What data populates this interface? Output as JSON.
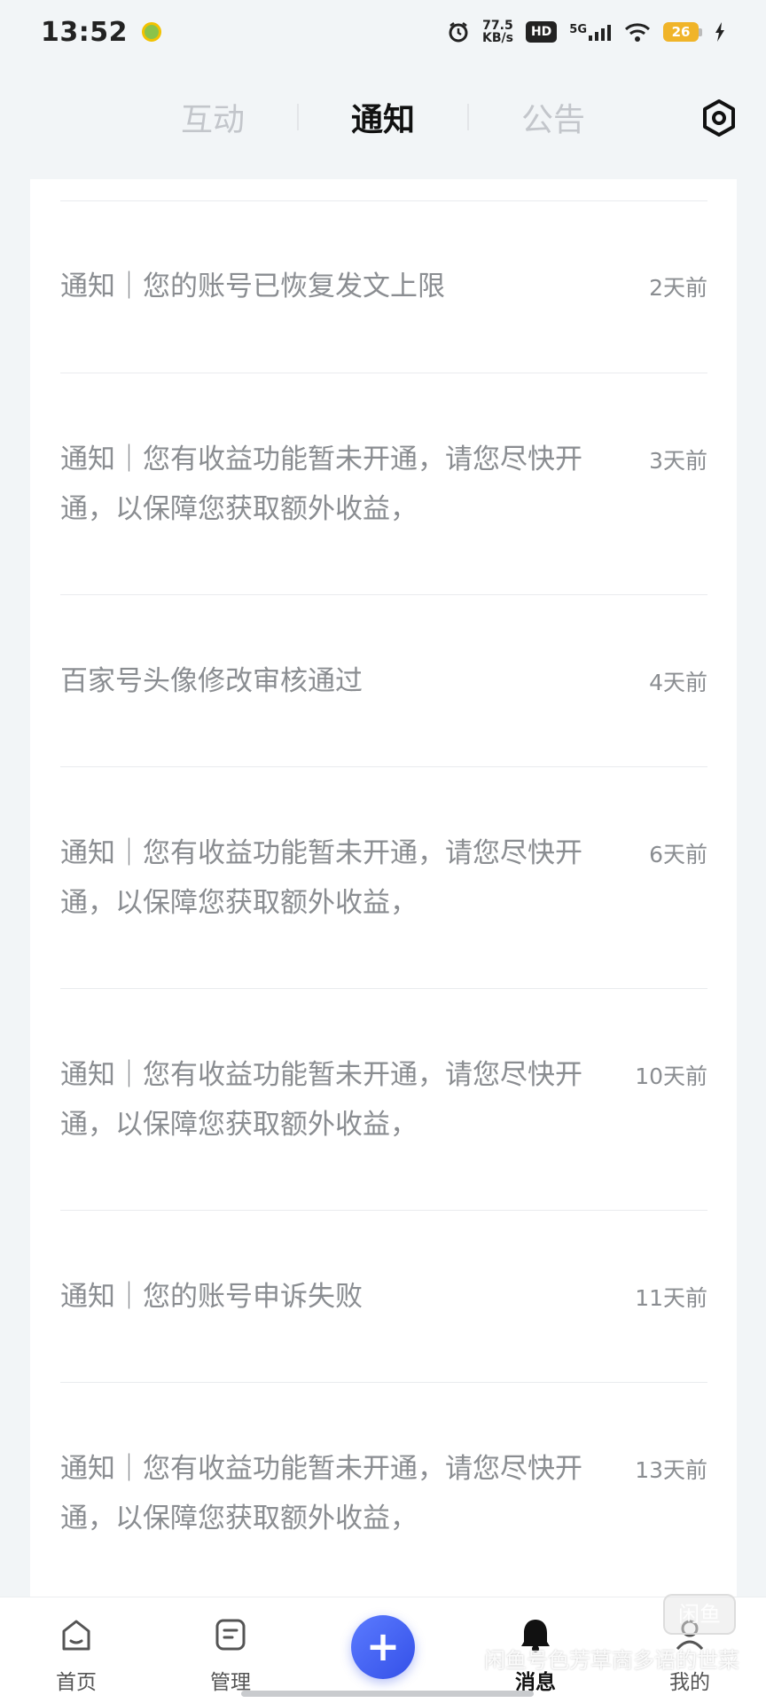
{
  "status_bar": {
    "time": "13:52",
    "speed_value": "77.5",
    "speed_unit": "KB/s",
    "hd_label": "HD",
    "network_label": "5G",
    "battery_level": "26"
  },
  "tabs": {
    "items": [
      {
        "label": "互动"
      },
      {
        "label": "通知"
      },
      {
        "label": "公告"
      }
    ],
    "active_index": 1
  },
  "notifications": [
    {
      "text": "通知｜您的账号已恢复发文上限",
      "time": "2天前"
    },
    {
      "text": "通知｜您有收益功能暂未开通，请您尽快开通，以保障您获取额外收益，",
      "time": "3天前"
    },
    {
      "text": "百家号头像修改审核通过",
      "time": "4天前"
    },
    {
      "text": "通知｜您有收益功能暂未开通，请您尽快开通，以保障您获取额外收益，",
      "time": "6天前"
    },
    {
      "text": "通知｜您有收益功能暂未开通，请您尽快开通，以保障您获取额外收益，",
      "time": "10天前"
    },
    {
      "text": "通知｜您的账号申诉失败",
      "time": "11天前"
    },
    {
      "text": "通知｜您有收益功能暂未开通，请您尽快开通，以保障您获取额外收益，",
      "time": "13天前"
    }
  ],
  "bottom_nav": {
    "home": "首页",
    "manage": "管理",
    "publish": "+",
    "messages": "消息",
    "mine": "我的"
  },
  "watermark": {
    "logo": "闲鱼",
    "text": "闲鱼号色芳草商多语的世菜"
  },
  "colors": {
    "accent": "#3450e8",
    "background": "#f2f5f7",
    "muted_text": "#8a8d91"
  }
}
